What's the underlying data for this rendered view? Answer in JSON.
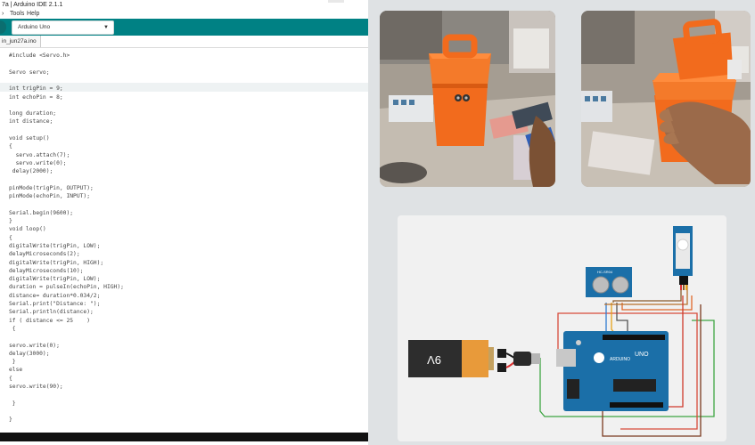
{
  "window": {
    "title": "7a | Arduino IDE 2.1.1"
  },
  "menu": {
    "tools": "Tools",
    "help": "Help"
  },
  "toolbar": {
    "board": "Arduino Uno"
  },
  "tab": {
    "label": "in_jun27a.ino"
  },
  "code": {
    "lines": [
      "#include <Servo.h>",
      "",
      "Servo servo;",
      "",
      "int trigPin = 9;",
      "int echoPin = 8;",
      "",
      "long duration;",
      "int distance;",
      "",
      "void setup()",
      "{",
      "  servo.attach(7);",
      "  servo.write(0);",
      " delay(2000);",
      "",
      "pinMode(trigPin, OUTPUT);",
      "pinMode(echoPin, INPUT);",
      "",
      "Serial.begin(9600);",
      "}",
      "void loop()",
      "{",
      "digitalWrite(trigPin, LOW);",
      "delayMicroseconds(2);",
      "digitalWrite(trigPin, HIGH);",
      "delayMicroseconds(10);",
      "digitalWrite(trigPin, LOW);",
      "duration = pulseIn(echoPin, HIGH);",
      "distance= duration*0.034/2;",
      "Serial.print(\"Distance: \");",
      "Serial.println(distance);",
      "if ( distance <= 25    )",
      " {",
      "",
      "servo.write(0);",
      "delay(3000);",
      " }",
      "else",
      "{",
      "servo.write(90);",
      "",
      " }",
      "",
      "}"
    ]
  },
  "circuit": {
    "battery_label": "9V",
    "sensor_label": "HC-SR04",
    "board_label": "UNO",
    "arduino_label": "ARDUINO"
  },
  "colors": {
    "teal": "#008184",
    "bin": "#f26b1d",
    "pcb": "#1b6fa8"
  }
}
